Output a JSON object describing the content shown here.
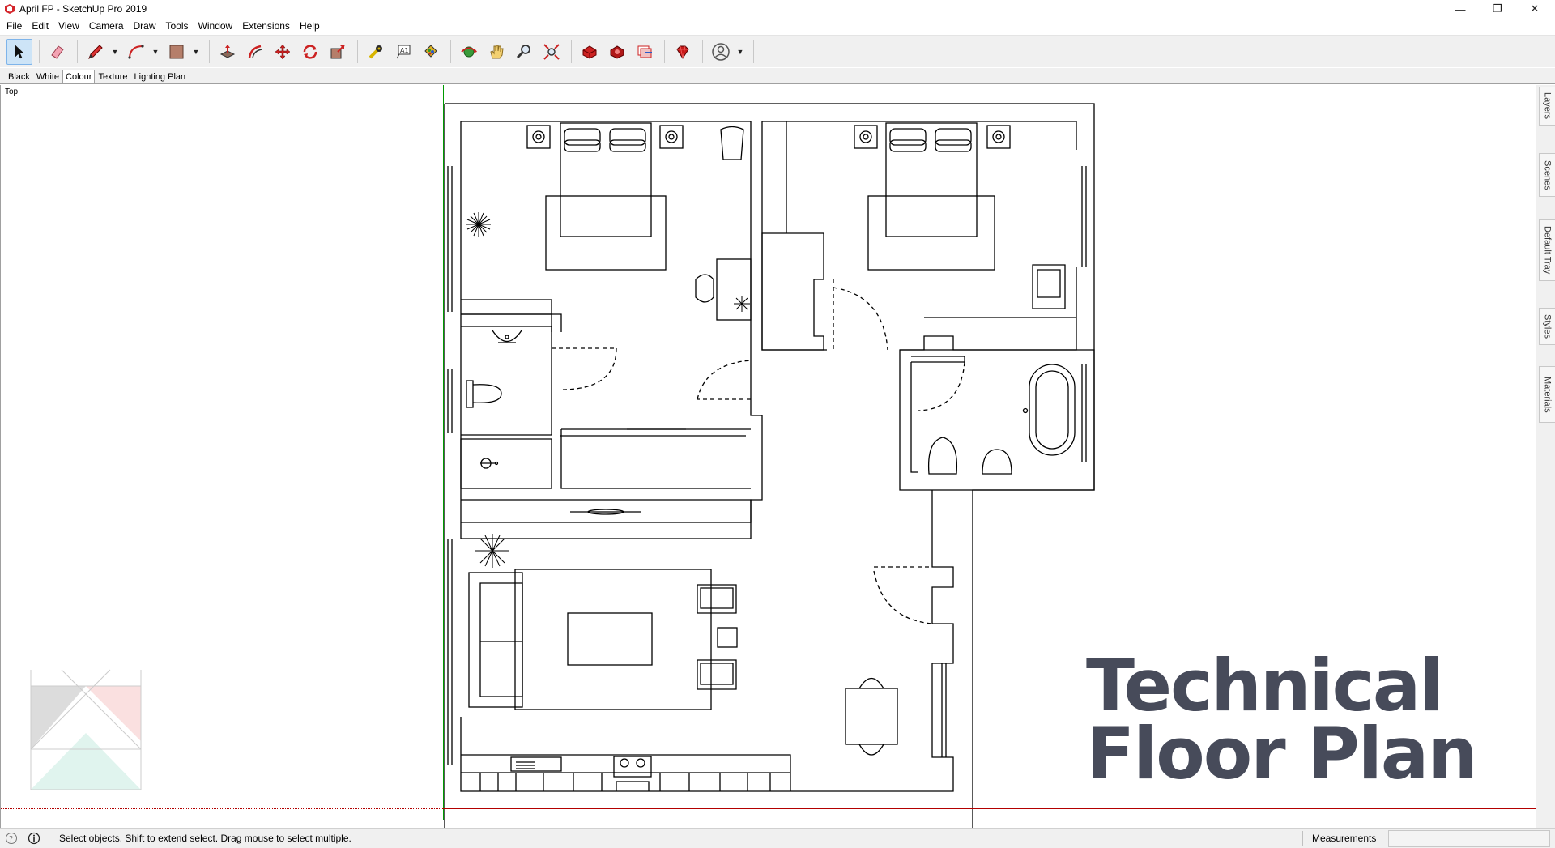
{
  "window": {
    "title": "April FP - SketchUp Pro 2019",
    "controls": {
      "minimize": "—",
      "restore": "❐",
      "close": "✕"
    }
  },
  "menu": [
    "File",
    "Edit",
    "View",
    "Camera",
    "Draw",
    "Tools",
    "Window",
    "Extensions",
    "Help"
  ],
  "toolbar": {
    "tools": [
      {
        "name": "select",
        "icon": "arrow-cursor-icon",
        "active": true
      },
      {
        "name": "eraser",
        "icon": "eraser-icon"
      },
      {
        "name": "line",
        "icon": "pencil-icon",
        "dropdown": true
      },
      {
        "name": "arc",
        "icon": "arc-icon",
        "dropdown": true
      },
      {
        "name": "rectangle",
        "icon": "rectangle-icon",
        "dropdown": true
      },
      {
        "name": "push-pull",
        "icon": "push-pull-icon"
      },
      {
        "name": "offset",
        "icon": "offset-icon"
      },
      {
        "name": "move",
        "icon": "move-icon"
      },
      {
        "name": "rotate",
        "icon": "rotate-icon"
      },
      {
        "name": "scale",
        "icon": "scale-icon"
      },
      {
        "name": "tape-measure",
        "icon": "tape-measure-icon"
      },
      {
        "name": "text",
        "icon": "text-icon"
      },
      {
        "name": "paint-bucket",
        "icon": "paint-bucket-icon"
      },
      {
        "name": "orbit",
        "icon": "orbit-icon"
      },
      {
        "name": "pan",
        "icon": "hand-icon"
      },
      {
        "name": "zoom",
        "icon": "magnifier-icon"
      },
      {
        "name": "zoom-extents",
        "icon": "zoom-extents-icon"
      },
      {
        "name": "3d-warehouse",
        "icon": "warehouse-icon"
      },
      {
        "name": "extension-warehouse",
        "icon": "extension-warehouse-icon"
      },
      {
        "name": "send-to-layout",
        "icon": "layout-icon"
      },
      {
        "name": "extension-manager",
        "icon": "ruby-gem-icon"
      },
      {
        "name": "account",
        "icon": "user-account-icon",
        "dropdown": true
      }
    ]
  },
  "style_tabs": [
    "Black",
    "White",
    "Colour",
    "Texture",
    "Lighting Plan"
  ],
  "viewport": {
    "view_label": "Top",
    "overlay_title_line1": "Technical",
    "overlay_title_line2": "Floor Plan"
  },
  "tray_tabs": [
    "Layers",
    "Scenes",
    "Default Tray",
    "Styles",
    "Materials"
  ],
  "status": {
    "message": "Select objects. Shift to extend select. Drag mouse to select multiple.",
    "measurements_label": "Measurements",
    "measurements_value": ""
  },
  "colors": {
    "overlay_title": "#474b5a",
    "green_axis": "#009a00",
    "red_axis": "#b30000",
    "selected_tool_bg": "#cde4f7"
  }
}
